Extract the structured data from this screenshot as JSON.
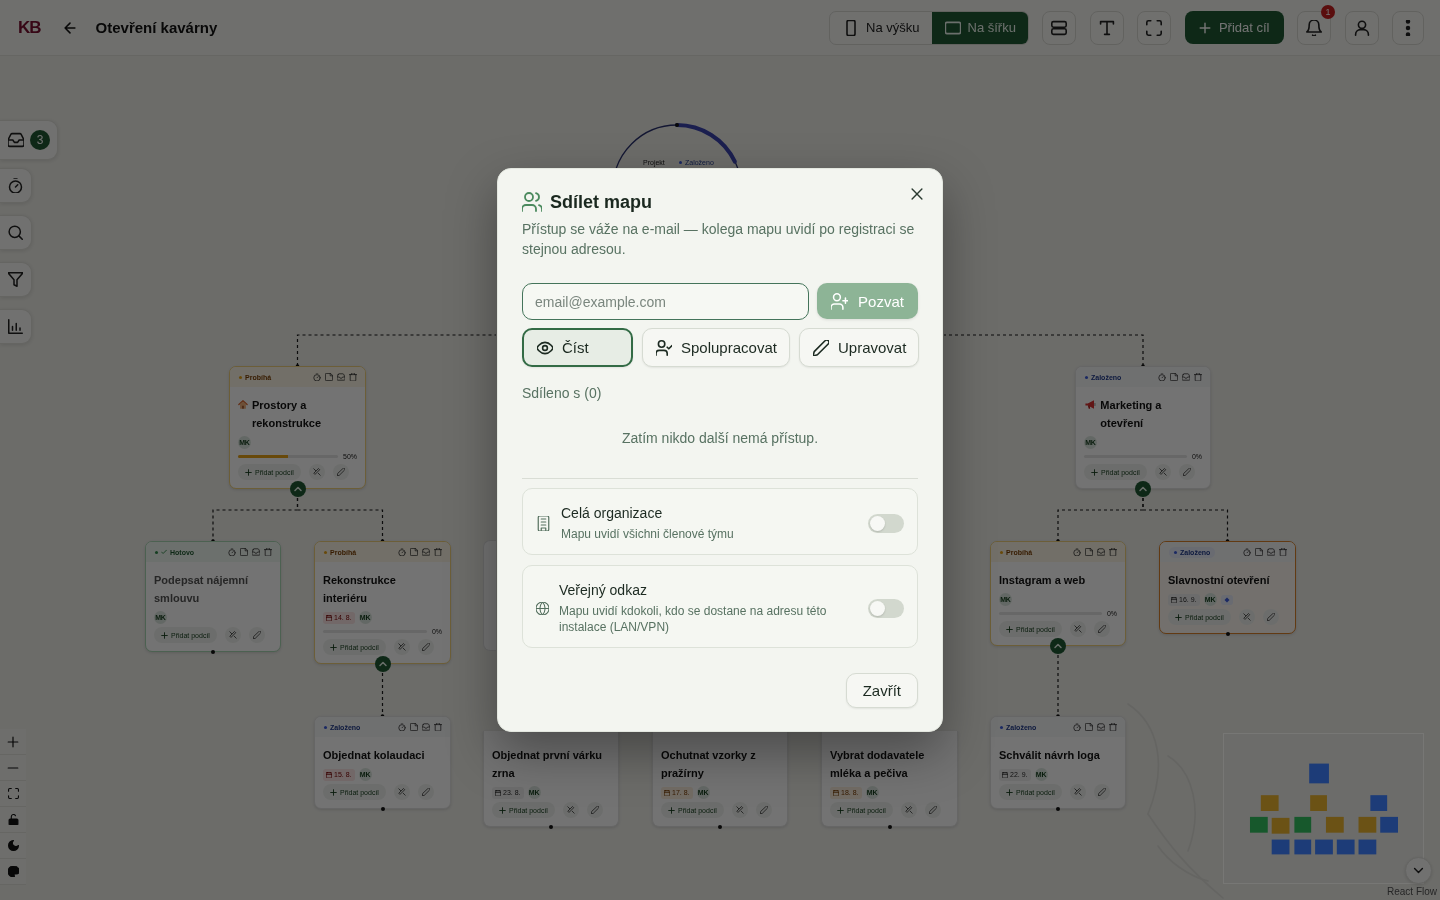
{
  "topbar": {
    "logo": "KB",
    "title": "Otevření kavárny",
    "view_toggle": [
      {
        "label": "Na výšku",
        "selected": false
      },
      {
        "label": "Na šířku",
        "selected": true
      }
    ],
    "add_goal_button": "Přidat cíl",
    "notification_badge": "1"
  },
  "side_toolbar": {
    "inbox_badge": "3"
  },
  "mind_map": {
    "root": {
      "label": "Projekt",
      "status": "Založeno"
    },
    "nodes": [
      {
        "status": {
          "label": "Probíhá",
          "kind": "in_progress"
        },
        "title": "Prostory a rekonstrukce",
        "avatar": "MK",
        "level": 0.5,
        "reading": "50%",
        "add_label": "Přidat podcíl",
        "selected": false,
        "milestone": false,
        "expanded": true,
        "children": [
          {
            "status": {
              "label": "Hotovo",
              "kind": "done"
            },
            "title": "Podepsat nájemní smlouvu",
            "avatar": "MK",
            "add_label": "Přidat podcíl",
            "selected": false,
            "milestone": false
          },
          {
            "status": {
              "label": "Probíhá",
              "kind": "in_progress"
            },
            "title": "Rekonstrukce interiéru",
            "date": {
              "text": "14. 8.",
              "kind": "overdue"
            },
            "avatar": "MK",
            "level": 0,
            "reading": "0%",
            "add_label": "Přidat podcíl",
            "selected": false,
            "milestone": false,
            "expanded": true,
            "children": [
              {
                "status": {
                  "label": "Založeno",
                  "kind": "new"
                },
                "title": "Objednat kolaudaci",
                "date": {
                  "text": "15. 8.",
                  "kind": "overdue"
                },
                "avatar": "MK",
                "add_label": "Přidat podcíl",
                "selected": false,
                "milestone": false
              }
            ]
          }
        ]
      },
      {
        "title": "Objednat první várku zrna",
        "date": {
          "text": "23. 8.",
          "kind": "planned"
        },
        "avatar": "MK",
        "add_label": "Přidat podcíl",
        "selected": false,
        "milestone": false
      },
      {
        "title": "Ochutnat vzorky z pražírny",
        "date": {
          "text": "17. 8.",
          "kind": "due_soon"
        },
        "avatar": "MK",
        "add_label": "Přidat podcíl",
        "selected": false,
        "milestone": false
      },
      {
        "title": "Vybrat dodavatele mléka a pečiva",
        "date": {
          "text": "18. 8.",
          "kind": "due_soon"
        },
        "avatar": "MK",
        "add_label": "Přidat podcíl",
        "selected": false,
        "milestone": false
      },
      {
        "status": {
          "label": "Založeno",
          "kind": "new"
        },
        "title": "Marketing a otevření",
        "avatar": "MK",
        "level": 0,
        "reading": "0%",
        "add_label": "Přidat podcíl",
        "selected": false,
        "milestone": false,
        "expanded": true,
        "children": [
          {
            "status": {
              "label": "Probíhá",
              "kind": "in_progress"
            },
            "title": "Instagram a web",
            "avatar": "MK",
            "level": 0,
            "reading": "0%",
            "add_label": "Přidat podcíl",
            "selected": false,
            "milestone": false,
            "expanded": true,
            "children": [
              {
                "status": {
                  "label": "Založeno",
                  "kind": "new"
                },
                "title": "Schválit návrh loga",
                "date": {
                  "text": "22. 9.",
                  "kind": "planned"
                },
                "avatar": "MK",
                "add_label": "Přidat podcíl",
                "selected": false,
                "milestone": false
              }
            ]
          },
          {
            "status": {
              "label": "Založeno",
              "kind": "new"
            },
            "title": "Slavnostní otevření",
            "date": {
              "text": "16. 9.",
              "kind": "planned"
            },
            "avatar": "MK",
            "add_label": "Přidat podcíl",
            "selected": true,
            "milestone": true
          }
        ]
      }
    ]
  },
  "minimap": {
    "nodes": [
      {
        "color": "#1d3c78"
      },
      {
        "color": "#6b5215"
      },
      {
        "color": "#6b5215"
      },
      {
        "color": "#1d3c78"
      },
      {
        "color": "#17582c"
      },
      {
        "color": "#6b5215"
      },
      {
        "color": "#17582c"
      },
      {
        "color": "#6b5215"
      },
      {
        "color": "#6b5215"
      },
      {
        "color": "#1d3c78"
      },
      {
        "color": "#1d3c78"
      },
      {
        "color": "#1d3c78"
      },
      {
        "color": "#1d3c78"
      },
      {
        "color": "#1d3c78"
      },
      {
        "color": "#1d3c78"
      }
    ]
  },
  "attribution": "React Flow",
  "share_dialog": {
    "title": "Sdílet mapu",
    "description": "Přístup se váže na e-mail — kolega mapu uvidí po registraci se stejnou adresou.",
    "email_field": {
      "placeholder": "email@example.com"
    },
    "invite_button": {
      "label": "Pozvat",
      "disabled": true
    },
    "roles": [
      {
        "label": "Číst",
        "selected": true
      },
      {
        "label": "Spolupracovat",
        "selected": false
      },
      {
        "label": "Upravovat",
        "selected": false
      }
    ],
    "shared_heading": "Sdíleno s (0)",
    "empty_message": "Zatím nikdo další nemá přístup.",
    "options": [
      {
        "title": "Celá organizace",
        "description": "Mapu uvidí všichni členové týmu",
        "on": false
      },
      {
        "title": "Veřejný odkaz",
        "description": "Mapu uvidí kdokoli, kdo se dostane na adresu této instalace (LAN/VPN)",
        "on": false
      }
    ],
    "close_button": "Zavřít"
  }
}
